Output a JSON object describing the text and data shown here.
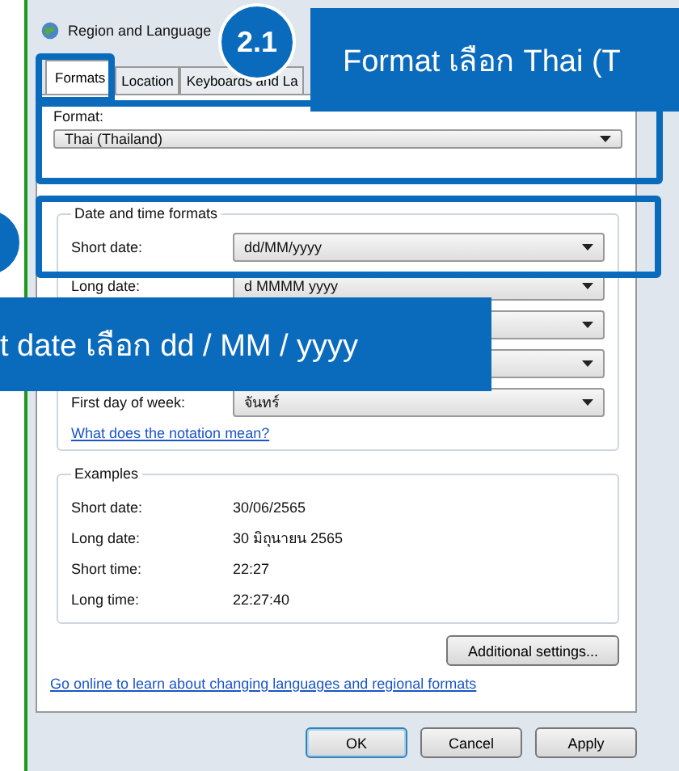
{
  "window": {
    "title": "Region and Language"
  },
  "tabs": [
    {
      "label": "Formats",
      "selected": true
    },
    {
      "label": "Location",
      "selected": false
    },
    {
      "label": "Keyboards and La",
      "selected": false
    }
  ],
  "format": {
    "label": "Format:",
    "value": "Thai (Thailand)"
  },
  "date_time_formats": {
    "title": "Date and time formats",
    "rows": [
      {
        "label": "Short date:",
        "value": "dd/MM/yyyy"
      },
      {
        "label": "Long date:",
        "value": "d MMMM yyyy"
      },
      {},
      {},
      {
        "label": "First day of week:",
        "value": "จันทร์"
      }
    ],
    "link": "What does the notation mean?"
  },
  "examples": {
    "title": "Examples",
    "rows": [
      {
        "label": "Short date:",
        "value": "30/06/2565"
      },
      {
        "label": "Long date:",
        "value": "30 มิถุนายน 2565"
      },
      {
        "label": "Short time:",
        "value": "22:27"
      },
      {
        "label": "Long time:",
        "value": "22:27:40"
      }
    ]
  },
  "additional_button": "Additional settings...",
  "online_link": "Go online to learn about changing languages and regional formats",
  "buttons": [
    {
      "label": "OK",
      "selected": true
    },
    {
      "label": "Cancel",
      "selected": false
    },
    {
      "label": "Apply",
      "selected": false
    }
  ],
  "callouts": [
    {
      "badge": "2.1",
      "text": "Format เลือก Thai (T"
    },
    {
      "text": "t date เลือก dd / MM / yyyy"
    }
  ]
}
